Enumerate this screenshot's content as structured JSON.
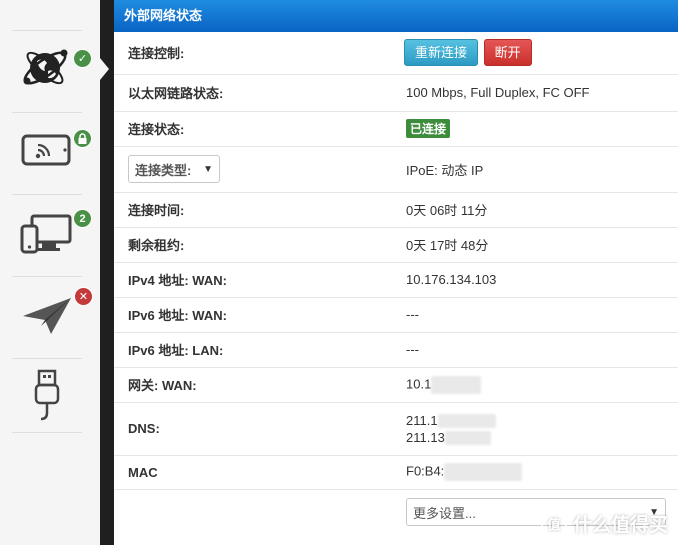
{
  "panel": {
    "title": "外部网络状态"
  },
  "sidebar": {
    "items": [
      {
        "icon": "globe-network-icon",
        "badge": "✓",
        "badge_color": "#4a9148"
      },
      {
        "icon": "wireless-tablet-icon",
        "badge": "lock",
        "badge_color": "#4a9148"
      },
      {
        "icon": "devices-icon",
        "badge": "2",
        "badge_color": "#4a9148"
      },
      {
        "icon": "paper-plane-icon",
        "badge": "✕",
        "badge_color": "#c23a3a"
      },
      {
        "icon": "usb-icon",
        "badge": ""
      }
    ]
  },
  "rows": {
    "control": {
      "label": "连接控制:",
      "reconnect": "重新连接",
      "disconnect": "断开"
    },
    "ethernet": {
      "label": "以太网链路状态:",
      "value": "100 Mbps, Full Duplex, FC OFF"
    },
    "status": {
      "label": "连接状态:",
      "value": "已连接"
    },
    "conn_type": {
      "select": "连接类型:",
      "value": "IPoE: 动态 IP"
    },
    "uptime": {
      "label": "连接时间:",
      "value": "0天 06时 11分"
    },
    "lease": {
      "label": "剩余租约:",
      "value": "0天 17时 48分"
    },
    "ipv4_wan": {
      "label": "IPv4 地址: WAN:",
      "value": "10.176.134.103"
    },
    "ipv6_wan": {
      "label": "IPv6 地址: WAN:",
      "value": "---"
    },
    "ipv6_lan": {
      "label": "IPv6 地址: LAN:",
      "value": "---"
    },
    "gateway": {
      "label": "网关: WAN:",
      "value": "10.1"
    },
    "dns": {
      "label": "DNS:",
      "value1": "211.1",
      "value2": "211.13"
    },
    "mac": {
      "label": "MAC",
      "value": "F0:B4:"
    },
    "more": {
      "select": "更多设置..."
    }
  },
  "watermark": {
    "logo": "值",
    "text": "什么值得买"
  }
}
